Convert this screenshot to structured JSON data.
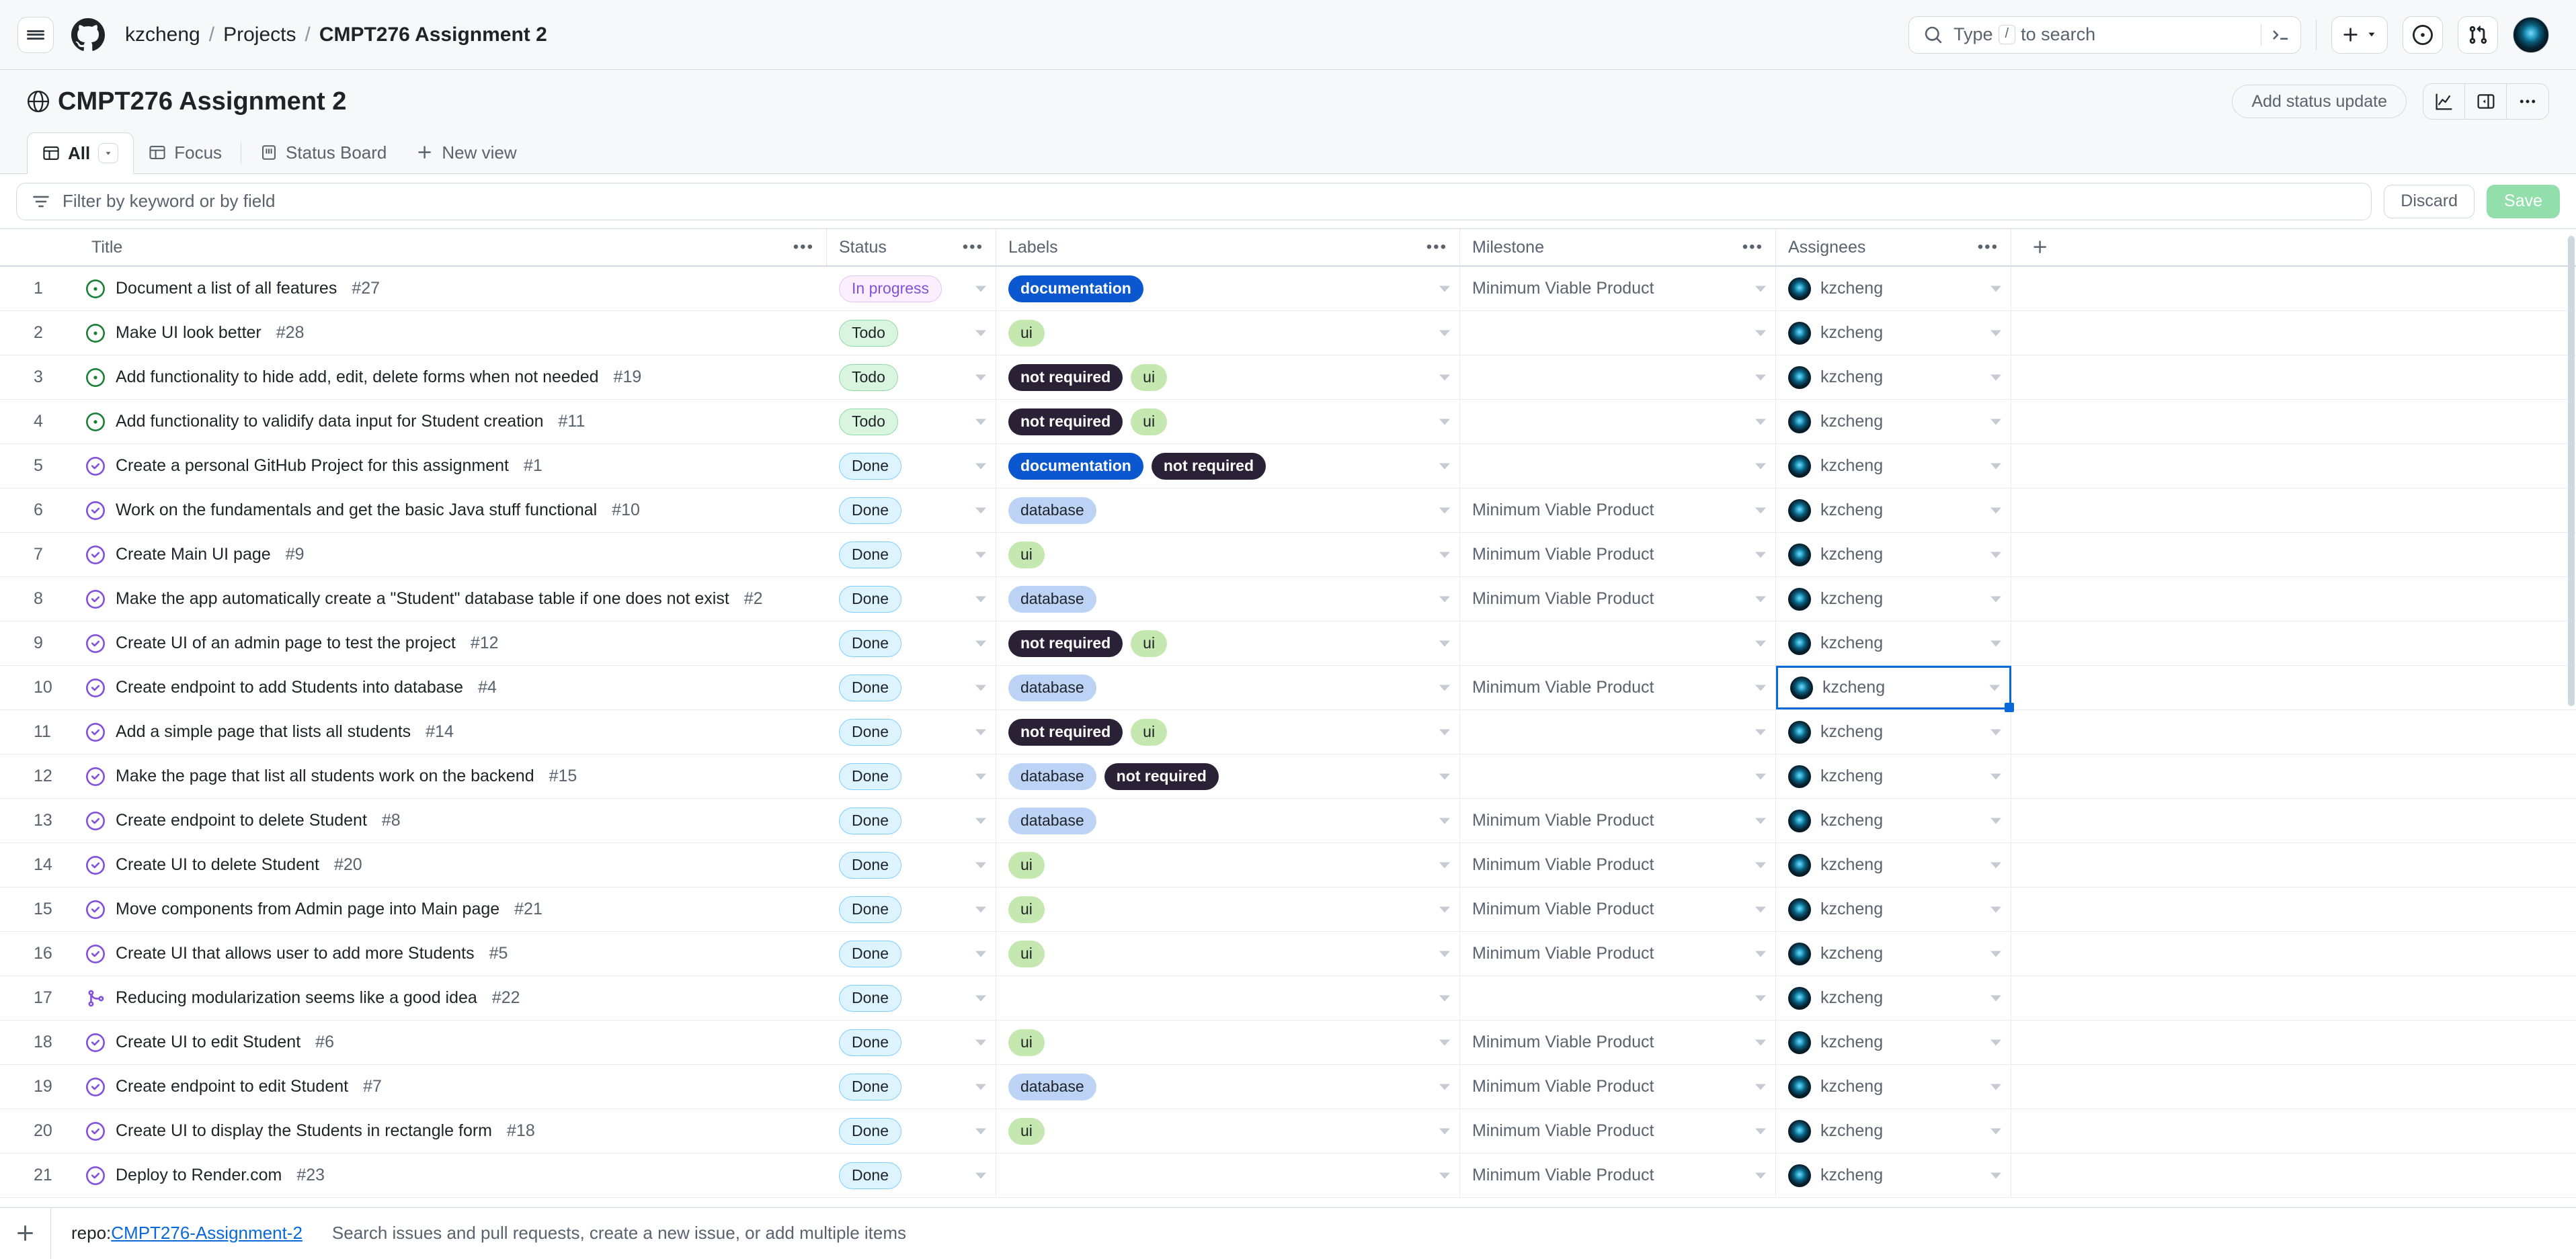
{
  "header": {
    "menu_icon": "hamburger-icon",
    "logo_icon": "github-logo-icon",
    "breadcrumb": {
      "owner": "kzcheng",
      "section": "Projects",
      "current": "CMPT276 Assignment 2",
      "separator": "/"
    },
    "search": {
      "placeholder_prefix": "Type",
      "slash_key": "/",
      "placeholder_suffix": "to search",
      "icon": "search-icon",
      "terminal_icon": "terminal-icon"
    },
    "actions": {
      "create_icon": "plus-icon",
      "create_caret": "chevron-down-icon",
      "issues_icon": "issue-opened-icon",
      "pulls_icon": "git-pull-request-icon",
      "avatar": "user-avatar"
    }
  },
  "project": {
    "icon": "project-globe-icon",
    "title": "CMPT276 Assignment 2",
    "status_update_label": "Add status update",
    "insights_icon": "graph-icon",
    "panel_icon": "sidebar-expand-icon",
    "more_icon": "kebab-horizontal-icon"
  },
  "views": {
    "tabs": [
      {
        "label": "All",
        "icon": "table-icon",
        "active": true,
        "has_caret": true
      },
      {
        "label": "Focus",
        "icon": "table-icon",
        "active": false,
        "has_caret": false
      },
      {
        "label": "Status Board",
        "icon": "board-icon",
        "active": false,
        "has_caret": false
      }
    ],
    "new_view_label": "New view",
    "new_view_icon": "plus-icon"
  },
  "filter": {
    "icon": "filter-icon",
    "placeholder": "Filter by keyword or by field",
    "value": "",
    "discard_label": "Discard",
    "save_label": "Save",
    "save_color": "#93dfab"
  },
  "table": {
    "columns": [
      {
        "key": "num",
        "label": ""
      },
      {
        "key": "title",
        "label": "Title",
        "has_menu": true
      },
      {
        "key": "status",
        "label": "Status",
        "has_menu": true
      },
      {
        "key": "labels",
        "label": "Labels",
        "has_menu": true
      },
      {
        "key": "milestone",
        "label": "Milestone",
        "has_menu": true
      },
      {
        "key": "assignees",
        "label": "Assignees",
        "has_menu": true
      },
      {
        "key": "add",
        "label": "",
        "icon": "plus-icon"
      }
    ],
    "menu_glyph": "•••",
    "rows": [
      {
        "num": "1",
        "icon": "issue-opened-icon",
        "title": "Document a list of all features",
        "number": "#27",
        "status": "In progress",
        "status_class": "st-inprogress",
        "labels": [
          {
            "text": "documentation",
            "cls": "lbl-documentation"
          }
        ],
        "milestone": "Minimum Viable Product",
        "assignee": "kzcheng"
      },
      {
        "num": "2",
        "icon": "issue-opened-icon",
        "title": "Make UI look better",
        "number": "#28",
        "status": "Todo",
        "status_class": "st-todo",
        "labels": [
          {
            "text": "ui",
            "cls": "lbl-ui"
          }
        ],
        "milestone": "",
        "assignee": "kzcheng"
      },
      {
        "num": "3",
        "icon": "issue-opened-icon",
        "title": "Add functionality to hide add, edit, delete forms when not needed",
        "number": "#19",
        "status": "Todo",
        "status_class": "st-todo",
        "labels": [
          {
            "text": "not required",
            "cls": "lbl-notrequired"
          },
          {
            "text": "ui",
            "cls": "lbl-ui"
          }
        ],
        "milestone": "",
        "assignee": "kzcheng"
      },
      {
        "num": "4",
        "icon": "issue-opened-icon",
        "title": "Add functionality to validify data input for Student creation",
        "number": "#11",
        "status": "Todo",
        "status_class": "st-todo",
        "labels": [
          {
            "text": "not required",
            "cls": "lbl-notrequired"
          },
          {
            "text": "ui",
            "cls": "lbl-ui"
          }
        ],
        "milestone": "",
        "assignee": "kzcheng"
      },
      {
        "num": "5",
        "icon": "issue-closed-icon",
        "title": "Create a personal GitHub Project for this assignment",
        "number": "#1",
        "status": "Done",
        "status_class": "st-done",
        "labels": [
          {
            "text": "documentation",
            "cls": "lbl-documentation"
          },
          {
            "text": "not required",
            "cls": "lbl-notrequired"
          }
        ],
        "milestone": "",
        "assignee": "kzcheng"
      },
      {
        "num": "6",
        "icon": "issue-closed-icon",
        "title": "Work on the fundamentals and get the basic Java stuff functional",
        "number": "#10",
        "status": "Done",
        "status_class": "st-done",
        "labels": [
          {
            "text": "database",
            "cls": "lbl-database"
          }
        ],
        "milestone": "Minimum Viable Product",
        "assignee": "kzcheng"
      },
      {
        "num": "7",
        "icon": "issue-closed-icon",
        "title": "Create Main UI page",
        "number": "#9",
        "status": "Done",
        "status_class": "st-done",
        "labels": [
          {
            "text": "ui",
            "cls": "lbl-ui"
          }
        ],
        "milestone": "Minimum Viable Product",
        "assignee": "kzcheng"
      },
      {
        "num": "8",
        "icon": "issue-closed-icon",
        "title": "Make the app automatically create a \"Student\" database table if one does not exist",
        "number": "#2",
        "status": "Done",
        "status_class": "st-done",
        "labels": [
          {
            "text": "database",
            "cls": "lbl-database"
          }
        ],
        "milestone": "Minimum Viable Product",
        "assignee": "kzcheng"
      },
      {
        "num": "9",
        "icon": "issue-closed-icon",
        "title": "Create UI of an admin page to test the project",
        "number": "#12",
        "status": "Done",
        "status_class": "st-done",
        "labels": [
          {
            "text": "not required",
            "cls": "lbl-notrequired"
          },
          {
            "text": "ui",
            "cls": "lbl-ui"
          }
        ],
        "milestone": "",
        "assignee": "kzcheng"
      },
      {
        "num": "10",
        "icon": "issue-closed-icon",
        "title": "Create endpoint to add Students into database",
        "number": "#4",
        "status": "Done",
        "status_class": "st-done",
        "labels": [
          {
            "text": "database",
            "cls": "lbl-database"
          }
        ],
        "milestone": "Minimum Viable Product",
        "assignee": "kzcheng",
        "selected_cell": "assignees"
      },
      {
        "num": "11",
        "icon": "issue-closed-icon",
        "title": "Add a simple page that lists all students",
        "number": "#14",
        "status": "Done",
        "status_class": "st-done",
        "labels": [
          {
            "text": "not required",
            "cls": "lbl-notrequired"
          },
          {
            "text": "ui",
            "cls": "lbl-ui"
          }
        ],
        "milestone": "",
        "assignee": "kzcheng"
      },
      {
        "num": "12",
        "icon": "issue-closed-icon",
        "title": "Make the page that list all students work on the backend",
        "number": "#15",
        "status": "Done",
        "status_class": "st-done",
        "labels": [
          {
            "text": "database",
            "cls": "lbl-database"
          },
          {
            "text": "not required",
            "cls": "lbl-notrequired"
          }
        ],
        "milestone": "",
        "assignee": "kzcheng"
      },
      {
        "num": "13",
        "icon": "issue-closed-icon",
        "title": "Create endpoint to delete Student",
        "number": "#8",
        "status": "Done",
        "status_class": "st-done",
        "labels": [
          {
            "text": "database",
            "cls": "lbl-database"
          }
        ],
        "milestone": "Minimum Viable Product",
        "assignee": "kzcheng"
      },
      {
        "num": "14",
        "icon": "issue-closed-icon",
        "title": "Create UI to delete Student",
        "number": "#20",
        "status": "Done",
        "status_class": "st-done",
        "labels": [
          {
            "text": "ui",
            "cls": "lbl-ui"
          }
        ],
        "milestone": "Minimum Viable Product",
        "assignee": "kzcheng"
      },
      {
        "num": "15",
        "icon": "issue-closed-icon",
        "title": "Move components from Admin page into Main page",
        "number": "#21",
        "status": "Done",
        "status_class": "st-done",
        "labels": [
          {
            "text": "ui",
            "cls": "lbl-ui"
          }
        ],
        "milestone": "Minimum Viable Product",
        "assignee": "kzcheng"
      },
      {
        "num": "16",
        "icon": "issue-closed-icon",
        "title": "Create UI that allows user to add more Students",
        "number": "#5",
        "status": "Done",
        "status_class": "st-done",
        "labels": [
          {
            "text": "ui",
            "cls": "lbl-ui"
          }
        ],
        "milestone": "Minimum Viable Product",
        "assignee": "kzcheng"
      },
      {
        "num": "17",
        "icon": "git-pull-request-merged-icon",
        "title": "Reducing modularization seems like a good idea",
        "number": "#22",
        "status": "Done",
        "status_class": "st-done",
        "labels": [],
        "milestone": "",
        "assignee": "kzcheng"
      },
      {
        "num": "18",
        "icon": "issue-closed-icon",
        "title": "Create UI to edit Student",
        "number": "#6",
        "status": "Done",
        "status_class": "st-done",
        "labels": [
          {
            "text": "ui",
            "cls": "lbl-ui"
          }
        ],
        "milestone": "Minimum Viable Product",
        "assignee": "kzcheng"
      },
      {
        "num": "19",
        "icon": "issue-closed-icon",
        "title": "Create endpoint to edit Student",
        "number": "#7",
        "status": "Done",
        "status_class": "st-done",
        "labels": [
          {
            "text": "database",
            "cls": "lbl-database"
          }
        ],
        "milestone": "Minimum Viable Product",
        "assignee": "kzcheng"
      },
      {
        "num": "20",
        "icon": "issue-closed-icon",
        "title": "Create UI to display the Students in rectangle form",
        "number": "#18",
        "status": "Done",
        "status_class": "st-done",
        "labels": [
          {
            "text": "ui",
            "cls": "lbl-ui"
          }
        ],
        "milestone": "Minimum Viable Product",
        "assignee": "kzcheng"
      },
      {
        "num": "21",
        "icon": "issue-closed-icon",
        "title": "Deploy to Render.com",
        "number": "#23",
        "status": "Done",
        "status_class": "st-done",
        "labels": [],
        "milestone": "Minimum Viable Product",
        "assignee": "kzcheng"
      }
    ]
  },
  "bottom": {
    "add_icon": "plus-icon",
    "repo_prefix": "repo:",
    "repo_name": "CMPT276-Assignment-2",
    "hint": "Search issues and pull requests, create a new issue, or add multiple items"
  },
  "colors": {
    "accent": "#0969da",
    "border": "#d1d9e0",
    "muted_text": "#59636e",
    "canvas_subtle": "#f6f8fa"
  }
}
